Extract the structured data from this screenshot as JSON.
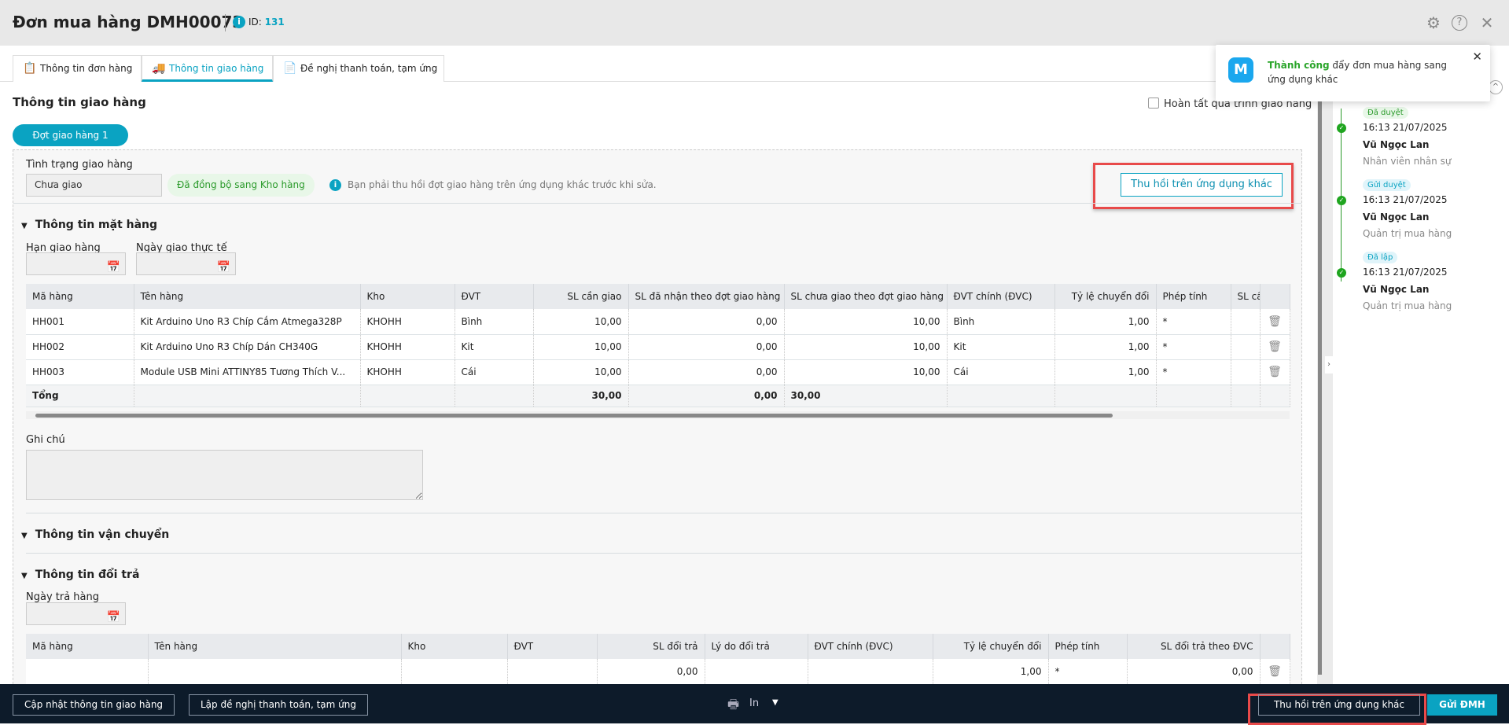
{
  "header": {
    "title": "Đơn mua hàng DMH00073",
    "id_label": "ID:",
    "id_value": "131"
  },
  "tabs": [
    {
      "label": "Thông tin đơn hàng"
    },
    {
      "label": "Thông tin giao hàng"
    },
    {
      "label": "Đề nghị thanh toán, tạm ứng"
    }
  ],
  "section_title": "Thông tin giao hàng",
  "complete_checkbox": "Hoàn tất quá trình giao hàng",
  "batch_pill": "Đợt giao hàng 1",
  "status": {
    "label": "Tình trạng giao hàng",
    "value": "Chưa giao",
    "sync_badge": "Đã đồng bộ sang Kho hàng",
    "info": "Bạn phải thu hồi đợt giao hàng trên ứng dụng khác trước khi sửa.",
    "recall_button": "Thu hồi trên ứng dụng khác"
  },
  "items_section": {
    "title": "Thông tin mặt hàng",
    "deadline_label": "Hạn giao hàng",
    "actual_label": "Ngày giao thực tế",
    "columns": [
      "Mã hàng",
      "Tên hàng",
      "Kho",
      "ĐVT",
      "SL cần giao",
      "SL đã nhận theo đợt giao hàng",
      "SL chưa giao theo đợt giao hàng",
      "ĐVT chính (ĐVC)",
      "Tỷ lệ chuyển đổi",
      "Phép tính",
      "SL cầ"
    ],
    "rows": [
      [
        "HH001",
        "Kit Arduino Uno R3 Chíp Cắm Atmega328P",
        "KHOHH",
        "Bình",
        "10,00",
        "0,00",
        "10,00",
        "Bình",
        "1,00",
        "*"
      ],
      [
        "HH002",
        "Kit Arduino Uno R3 Chíp Dán CH340G",
        "KHOHH",
        "Kit",
        "10,00",
        "0,00",
        "10,00",
        "Kit",
        "1,00",
        "*"
      ],
      [
        "HH003",
        "Module USB Mini ATTINY85 Tương Thích V...",
        "KHOHH",
        "Cái",
        "10,00",
        "0,00",
        "10,00",
        "Cái",
        "1,00",
        "*"
      ]
    ],
    "total_label": "Tổng",
    "total_need": "30,00",
    "total_received": "0,00",
    "total_pending": "30,00"
  },
  "note_label": "Ghi chú",
  "shipping_title": "Thông tin vận chuyển",
  "return_section": {
    "title": "Thông tin đổi trả",
    "date_label": "Ngày trả hàng",
    "columns": [
      "Mã hàng",
      "Tên hàng",
      "Kho",
      "ĐVT",
      "SL đổi trả",
      "Lý do đổi trả",
      "ĐVT chính (ĐVC)",
      "Tỷ lệ chuyển đổi",
      "Phép tính",
      "SL đổi trả theo ĐVC"
    ],
    "row": [
      "",
      "",
      "",
      "",
      "0,00",
      "",
      "",
      "1,00",
      "*",
      "0,00"
    ]
  },
  "toast": {
    "strong": "Thành công",
    "text": " đẩy đơn mua hàng sang ứng dụng khác"
  },
  "timeline": [
    {
      "badge": "Đã duyệt",
      "time": "16:13 21/07/2025",
      "name": "Vũ Ngọc Lan",
      "role": "Nhân viên nhân sự"
    },
    {
      "badge": "Gửi duyệt",
      "time": "16:13 21/07/2025",
      "name": "Vũ Ngọc Lan",
      "role": "Quản trị mua hàng"
    },
    {
      "badge": "Đã lập",
      "time": "16:13 21/07/2025",
      "name": "Vũ Ngọc Lan",
      "role": "Quản trị mua hàng"
    }
  ],
  "footer": {
    "update": "Cập nhật thông tin giao hàng",
    "payment": "Lập đề nghị thanh toán, tạm ứng",
    "print": "In",
    "recall": "Thu hồi trên ứng dụng khác",
    "send": "Gửi ĐMH"
  }
}
